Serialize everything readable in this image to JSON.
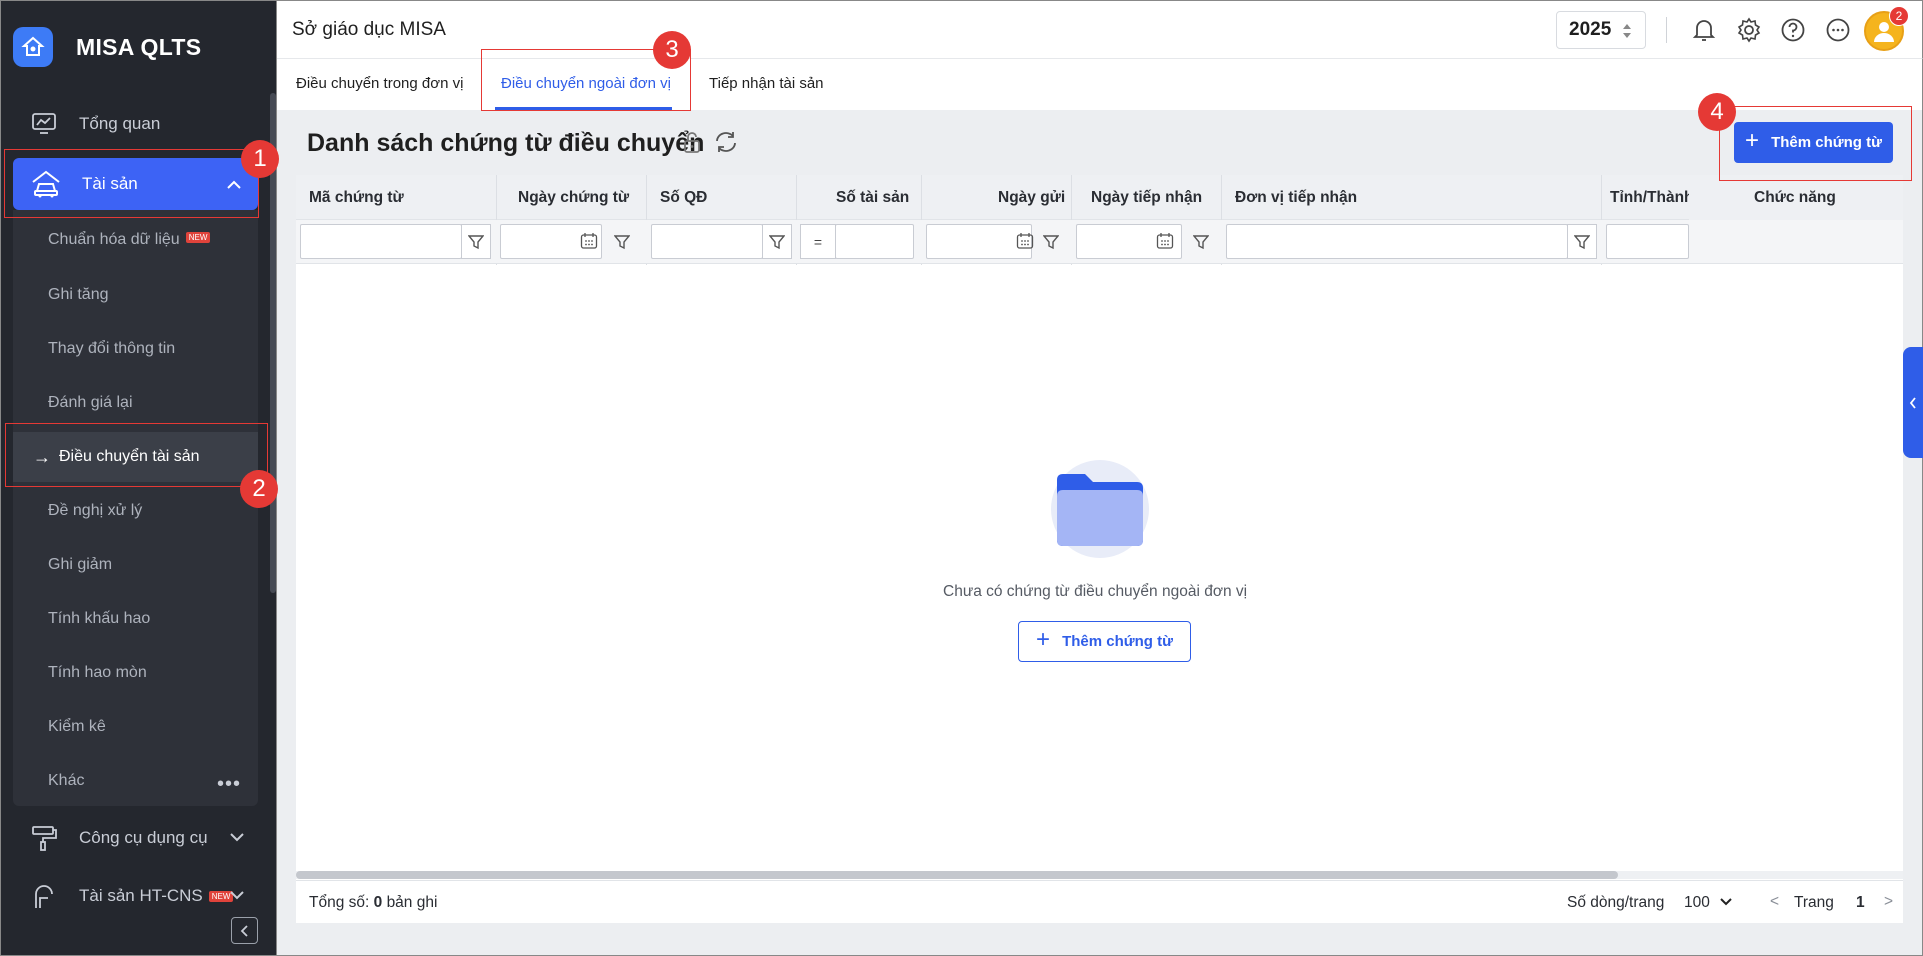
{
  "sidebar": {
    "brand": "MISA QLTS",
    "overview": "Tổng quan",
    "assets": "Tài sản",
    "sub_items": [
      "Chuẩn hóa dữ liệu",
      "Ghi tăng",
      "Thay đổi thông tin",
      "Đánh giá lại",
      "Điều chuyển tài sản",
      "Đề nghị xử lý",
      "Ghi giảm",
      "Tính khấu hao",
      "Tính hao mòn",
      "Kiểm kê",
      "Khác"
    ],
    "new_badge": "NEW",
    "tools": "Công cụ dụng cụ",
    "infra": "Tài sản HT-CNS"
  },
  "annotations": [
    "1",
    "2",
    "3",
    "4"
  ],
  "header": {
    "org": "Sở giáo dục MISA",
    "year": "2025",
    "notification_count": "2"
  },
  "tabs": [
    "Điều chuyển trong đơn vị",
    "Điều chuyển ngoài đơn vị",
    "Tiếp nhận tài sản"
  ],
  "page": {
    "title": "Danh sách chứng từ điều chuyển",
    "add_button": "Thêm chứng từ"
  },
  "grid": {
    "columns": [
      "Mã chứng từ",
      "Ngày chứng từ",
      "Số QĐ",
      "Số tài sản",
      "Ngày gửi",
      "Ngày tiếp nhận",
      "Đơn vị tiếp nhận",
      "Tỉnh/Thành",
      "Chức năng"
    ],
    "eq_operator": "=",
    "empty_text": "Chưa có chứng từ điều chuyển ngoài đơn vị",
    "empty_add": "Thêm chứng từ"
  },
  "footer": {
    "total_label": "Tổng số:",
    "total_count": "0",
    "total_unit": "bản ghi",
    "rows_label": "Số dòng/trang",
    "rows_value": "100",
    "prev": "<",
    "page_label": "Trang",
    "page_num": "1",
    "next": ">"
  },
  "colors": {
    "primary": "#2f5de8",
    "sidebar_bg": "#24272e",
    "annotation": "#e53935"
  }
}
